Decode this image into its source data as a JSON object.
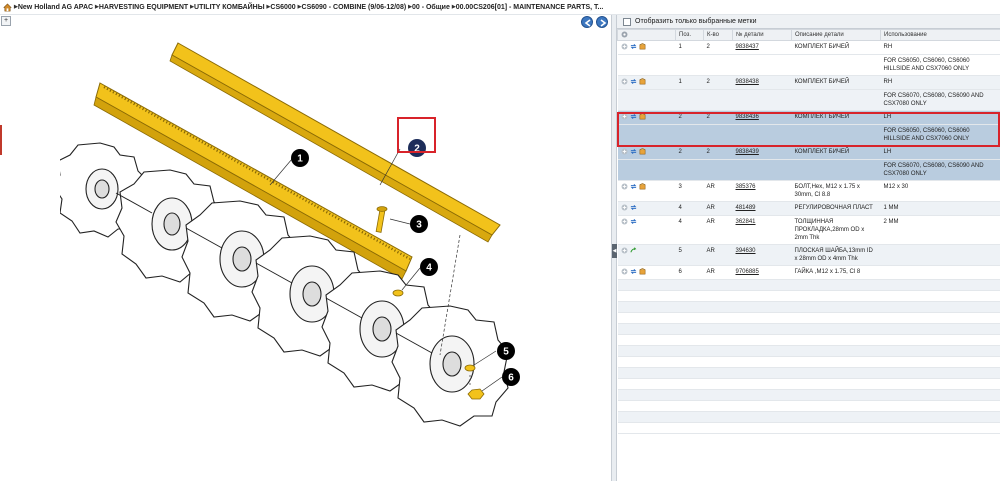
{
  "breadcrumb": [
    "New Holland AG APAC",
    "HARVESTING EQUIPMENT",
    "UTILITY КОМБАЙНЫ",
    "CS6000",
    "CS6090 - COMBINE (9/06-12/08)",
    "00 - Общие",
    "00.00CS206[01] - MAINTENANCE PARTS, T..."
  ],
  "filter": {
    "label": "Отобразить только выбранные метки"
  },
  "callouts": [
    "1",
    "2",
    "3",
    "4",
    "5",
    "6"
  ],
  "table": {
    "headers": {
      "pos": "Поз.",
      "qty": "К-во",
      "part": "№ детали",
      "desc": "Описание детали",
      "usage": "Использование"
    },
    "rows": [
      {
        "pos": "1",
        "qty": "2",
        "part": "9838437",
        "desc": "КОМПЛЕКТ БИЧЕЙ",
        "usage": "RH",
        "usage2": "FOR CS6050, CS6060, CS6060 HILLSIDE AND CSX7060 ONLY"
      },
      {
        "pos": "1",
        "qty": "2",
        "part": "9838438",
        "desc": "КОМПЛЕКТ БИЧЕЙ",
        "usage": "RH",
        "usage2": "FOR CS6070, CS6080, CS6090 AND CSX7080 ONLY"
      },
      {
        "pos": "2",
        "qty": "2",
        "part": "9838436",
        "desc": "КОМПЛЕКТ БИЧЕЙ",
        "usage": "LH",
        "usage2": "FOR CS6050, CS6060, CS6060 HILLSIDE AND CSX7060 ONLY"
      },
      {
        "pos": "2",
        "qty": "2",
        "part": "9838439",
        "desc": "КОМПЛЕКТ БИЧЕЙ",
        "usage": "LH",
        "usage2": "FOR CS6070, CS6080, CS6090 AND CSX7080 ONLY"
      },
      {
        "pos": "3",
        "qty": "AR",
        "part": "385376",
        "desc": "БОЛТ,Hex, M12 x 1.75 x 30mm, Cl 8.8",
        "usage": "M12 x 30"
      },
      {
        "pos": "4",
        "qty": "AR",
        "part": "481489",
        "desc": "РЕГУЛИРОВОЧНАЯ ПЛАСТ",
        "usage": "1 MM"
      },
      {
        "pos": "4",
        "qty": "AR",
        "part": "362841",
        "desc": "ТОЛЩИННАЯ ПРОКЛАДКА,28mm OD x 2mm Thk",
        "usage": "2 MM"
      },
      {
        "pos": "5",
        "qty": "AR",
        "part": "394630",
        "desc": "ПЛОСКАЯ ШАЙБА,13mm ID x 28mm OD x 4mm Thk",
        "usage": ""
      },
      {
        "pos": "6",
        "qty": "AR",
        "part": "9706885",
        "desc": "ГАЙКА ,M12 x 1.75, Cl 8",
        "usage": ""
      }
    ]
  },
  "colors": {
    "accent": "#3c77c0",
    "selection": "#b9ccdf",
    "highlight": "#d8232a",
    "part_yellow": "#f2c21b"
  }
}
